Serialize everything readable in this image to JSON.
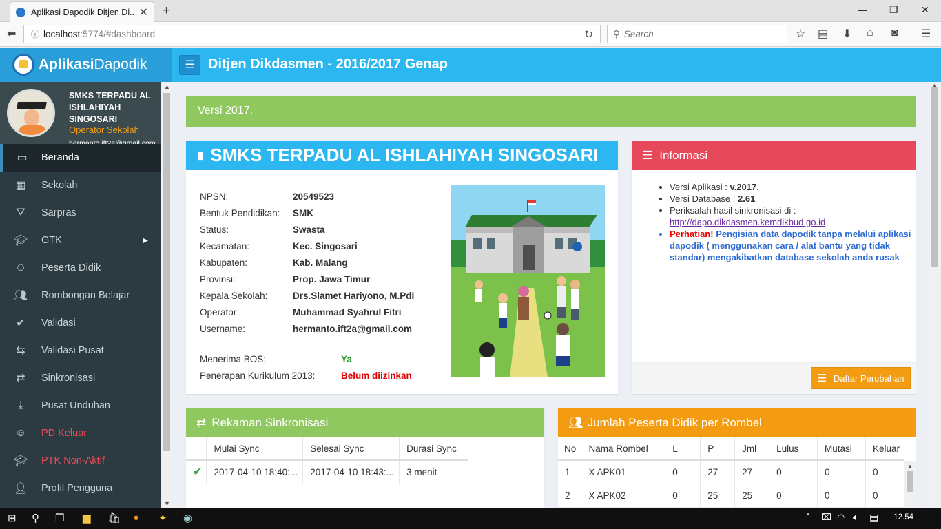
{
  "browser": {
    "tab_title": "Aplikasi Dapodik Ditjen Di...",
    "url_host": "localhost",
    "url_rest": ":5774/#dashboard",
    "search_placeholder": "Search"
  },
  "header": {
    "logo_bold": "Aplikasi",
    "logo_light": "Dapodik",
    "title": "Ditjen Dikdasmen - 2016/2017 Genap"
  },
  "user": {
    "school": "SMKS TERPADU AL ISHLAHIYAH SINGOSARI",
    "role": "Operator Sekolah",
    "email": "hermanto.ift2a@gmail.com"
  },
  "sidebar": {
    "items": [
      {
        "label": "Beranda",
        "icon": "monitor-icon"
      },
      {
        "label": "Sekolah",
        "icon": "building-icon"
      },
      {
        "label": "Sarpras",
        "icon": "road-icon"
      },
      {
        "label": "GTK",
        "icon": "graduation-cap-icon"
      },
      {
        "label": "Peserta Didik",
        "icon": "smile-icon"
      },
      {
        "label": "Rombongan Belajar",
        "icon": "users-icon"
      },
      {
        "label": "Validasi",
        "icon": "check-icon"
      },
      {
        "label": "Validasi Pusat",
        "icon": "retweet-icon"
      },
      {
        "label": "Sinkronisasi",
        "icon": "exchange-icon"
      },
      {
        "label": "Pusat Unduhan",
        "icon": "download-icon"
      },
      {
        "label": "PD Keluar",
        "icon": "smile-icon"
      },
      {
        "label": "PTK Non-Aktif",
        "icon": "graduation-cap-icon"
      },
      {
        "label": "Profil Pengguna",
        "icon": "user-icon"
      }
    ]
  },
  "versi_banner": "Versi 2017.",
  "school_box": {
    "title": "SMKS TERPADU AL ISHLAHIYAH SINGOSARI",
    "rows": [
      {
        "k": "NPSN:",
        "v": "20549523"
      },
      {
        "k": "Bentuk Pendidikan:",
        "v": "SMK"
      },
      {
        "k": "Status:",
        "v": "Swasta"
      },
      {
        "k": "Kecamatan:",
        "v": "Kec. Singosari"
      },
      {
        "k": "Kabupaten:",
        "v": "Kab. Malang"
      },
      {
        "k": "Provinsi:",
        "v": "Prop. Jawa Timur"
      },
      {
        "k": "Kepala Sekolah:",
        "v": "Drs.Slamet Hariyono, M.PdI"
      },
      {
        "k": "Operator:",
        "v": "Muhammad Syahrul Fitri"
      },
      {
        "k": "Username:",
        "v": "hermanto.ift2a@gmail.com"
      }
    ],
    "bos_label": "Menerima BOS:",
    "bos_value": "Ya",
    "k13_label": "Penerapan Kurikulum 2013:",
    "k13_value": "Belum diizinkan",
    "colors": {
      "bos": "#2e9e2e",
      "k13": "#e00000"
    }
  },
  "info_box": {
    "title": "Informasi",
    "versi_aplikasi_label": "Versi Aplikasi : ",
    "versi_aplikasi": "v.2017.",
    "versi_db_label": "Versi Database : ",
    "versi_db": "2.61",
    "periksa": "Periksalah hasil sinkronisasi di :",
    "link": "http://dapo.dikdasmen.kemdikbud.go.id",
    "warn_label": "Perhatian!",
    "warn_text": " Pengisian data dapodik tanpa melalui aplikasi dapodik ( menggunakan cara / alat bantu yang tidak standar) mengakibatkan database sekolah anda rusak",
    "button": "Daftar Perubahan"
  },
  "sync_box": {
    "title": "Rekaman Sinkronisasi",
    "columns": [
      "",
      "Mulai Sync",
      "Selesai Sync",
      "Durasi Sync"
    ],
    "rows": [
      {
        "mulai": "2017-04-10 18:40:...",
        "selesai": "2017-04-10 18:43:...",
        "durasi": "3 menit"
      }
    ]
  },
  "rombel_box": {
    "title": "Jumlah Peserta Didik per Rombel",
    "columns": [
      "No",
      "Nama Rombel",
      "L",
      "P",
      "Jml",
      "Lulus",
      "Mutasi",
      "Keluar"
    ],
    "rows": [
      [
        "1",
        "X APK01",
        "0",
        "27",
        "27",
        "0",
        "0",
        "0"
      ],
      [
        "2",
        "X APK02",
        "0",
        "25",
        "25",
        "0",
        "0",
        "0"
      ]
    ]
  },
  "taskbar": {
    "clock": "12.54"
  }
}
